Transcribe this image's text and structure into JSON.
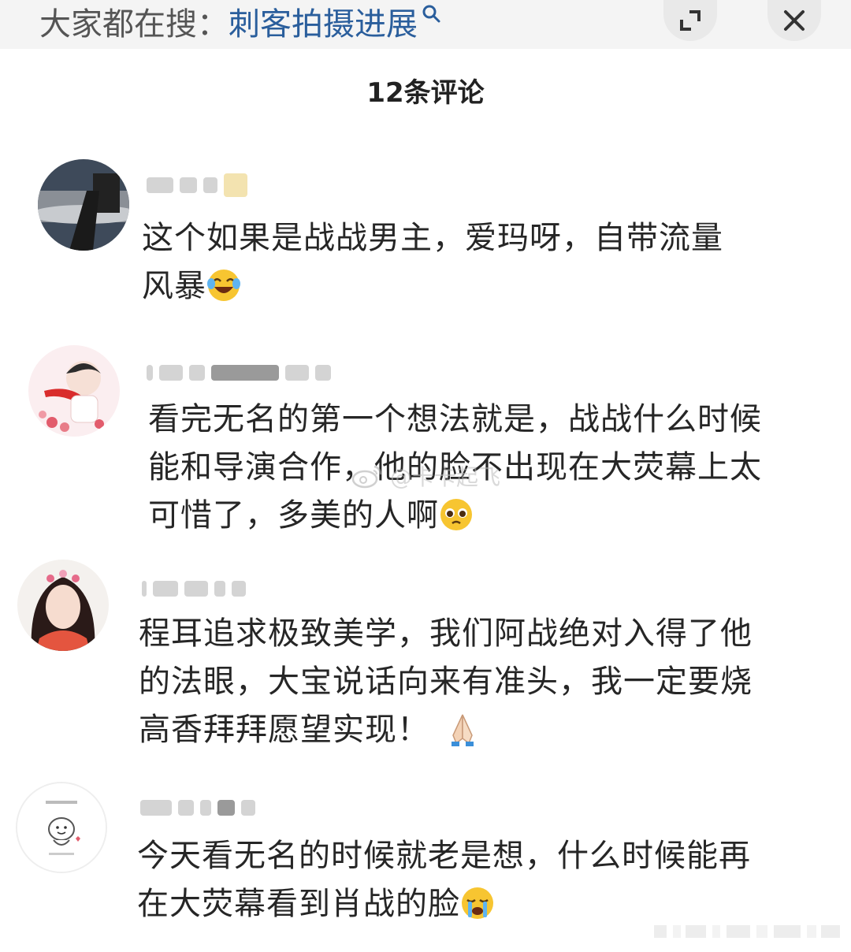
{
  "header": {
    "search_prefix": "大家都在搜：",
    "search_term": "刺客拍摄进展",
    "search_icon": "search-icon",
    "expand_icon": "expand-icon",
    "close_icon": "close-icon"
  },
  "comments_title": "12条评论",
  "comments": [
    {
      "text_line1": "这个如果是战战男主，爱玛呀，自带流量",
      "text_line2": "风暴",
      "emoji": "laugh-cry-emoji"
    },
    {
      "text_line1": "看完无名的第一个想法就是，战战什么时候",
      "text_line2": "能和导演合作，他的脸不出现在大荧幕上太",
      "text_line3": "可惜了，多美的人啊",
      "emoji": "pleading-face-emoji"
    },
    {
      "text_line1": "程耳追求极致美学，我们阿战绝对入得了他",
      "text_line2": "的法眼，大宝说话向来有准头，我一定要烧",
      "text_line3": "高香拜拜愿望实现！",
      "emoji": "folded-hands-emoji"
    },
    {
      "text_line1": "今天看无名的时候就老是想，什么时候能再",
      "text_line2": "在大荧幕看到肖战的脸",
      "emoji": "crying-face-emoji"
    }
  ],
  "watermark": {
    "text": "@卡卡起飞",
    "icon": "weibo-logo-icon"
  }
}
